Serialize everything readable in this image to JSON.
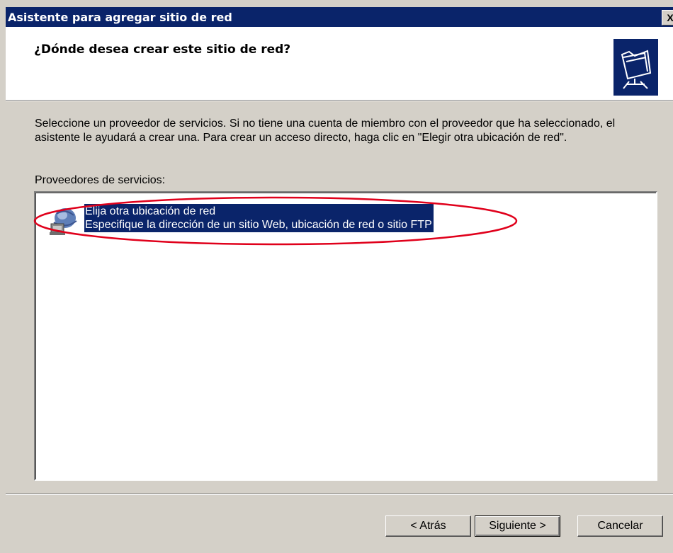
{
  "window": {
    "title": "Asistente para agregar sitio de red",
    "close_label": "X"
  },
  "header": {
    "heading": "¿Dónde desea crear este sitio de red?",
    "icon": "network-folder-icon"
  },
  "body": {
    "description": "Seleccione un proveedor de servicios. Si no tiene una cuenta de miembro con el proveedor que ha seleccionado, el asistente le ayudará a crear una. Para crear un acceso directo, haga clic en \"Elegir otra ubicación de red\".",
    "list_label": "Proveedores de servicios:",
    "providers": [
      {
        "title": "Elija otra ubicación de red",
        "subtitle": "Especifique la dirección de un sitio Web, ubicación de red o sitio FTP",
        "icon": "network-globe-icon",
        "selected": true
      }
    ]
  },
  "buttons": {
    "back": "< Atrás",
    "next": "Siguiente >",
    "cancel": "Cancelar"
  },
  "colors": {
    "titlebar": "#0a246a",
    "selection": "#0a246a",
    "annotation": "#e0001b",
    "face": "#d4d0c8"
  }
}
